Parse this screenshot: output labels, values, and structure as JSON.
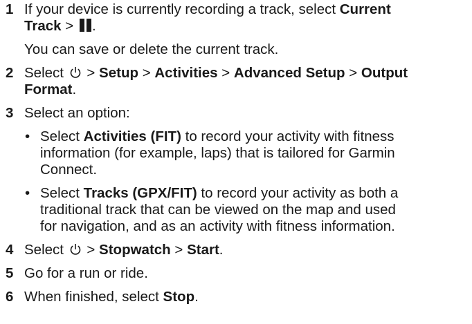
{
  "steps": [
    {
      "number": "1",
      "lines": [
        {
          "pre": "If your device is currently recording a track, select ",
          "bold": "Current"
        },
        {
          "bold": "Track",
          "post": " > "
        }
      ],
      "note": "You can save or delete the current track."
    },
    {
      "number": "2",
      "line1": {
        "pre": "Select ",
        "sep1": " > ",
        "b1": "Setup",
        "sep2": " > ",
        "b2": "Activities",
        "sep3": " > ",
        "b3": "Advanced Setup",
        "sep4": " > ",
        "b4": "Output"
      },
      "line2": {
        "bold": "Format",
        "post": "."
      }
    },
    {
      "number": "3",
      "text": "Select an option:",
      "options": [
        {
          "bullet": "•",
          "lines": [
            {
              "pre": "Select ",
              "bold": "Activities (FIT)",
              "post": " to record your activity with fitness"
            },
            {
              "text": "information (for example, laps) that is tailored for Garmin"
            },
            {
              "text": "Connect."
            }
          ]
        },
        {
          "bullet": "•",
          "lines": [
            {
              "pre": "Select ",
              "bold": "Tracks (GPX/FIT)",
              "post": " to record your activity as both a"
            },
            {
              "text": "traditional track that can be viewed on the map and used"
            },
            {
              "text": "for navigation, and as an activity with fitness information."
            }
          ]
        }
      ]
    },
    {
      "number": "4",
      "pre": "Select ",
      "sep1": " > ",
      "b1": "Stopwatch",
      "sep2": " > ",
      "b2": "Start",
      "post": "."
    },
    {
      "number": "5",
      "text": "Go for a run or ride."
    },
    {
      "number": "6",
      "pre": "When finished, select ",
      "bold": "Stop",
      "post": "."
    }
  ],
  "icons": {
    "pause": "pause-icon",
    "power": "power-icon"
  }
}
